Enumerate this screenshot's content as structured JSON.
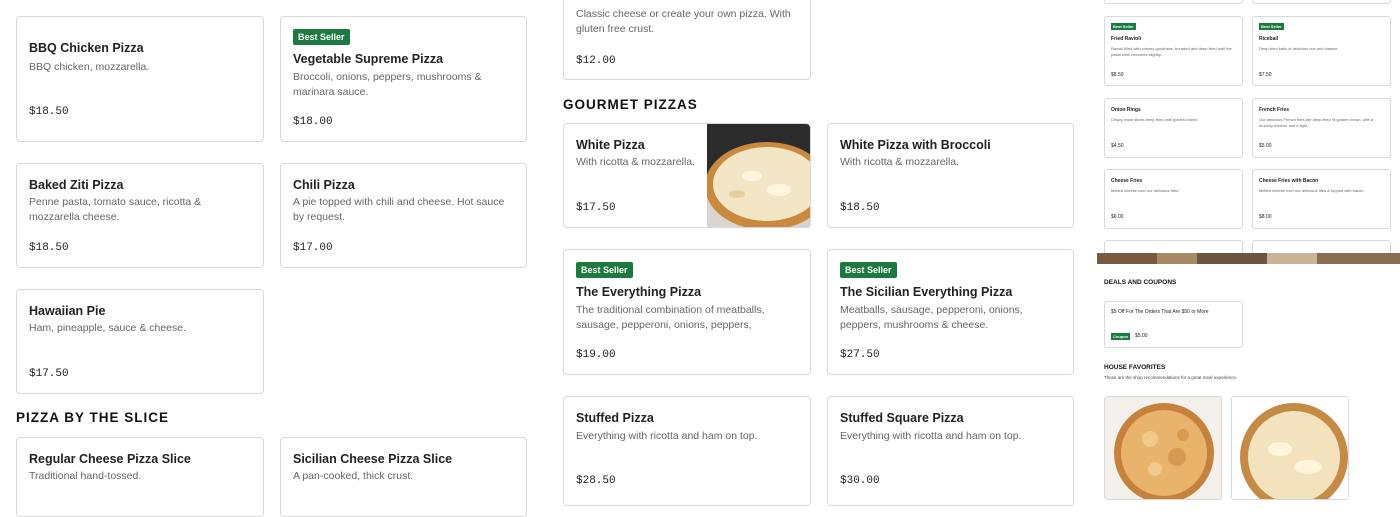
{
  "left_col": {
    "bbq": {
      "name": "BBQ Chicken Pizza",
      "desc": "BBQ chicken, mozzarella.",
      "price": "$18.50"
    },
    "veg": {
      "badge": "Best Seller",
      "name": "Vegetable Supreme Pizza",
      "desc": "Broccoli, onions, peppers, mushrooms & marinara sauce.",
      "price": "$18.00"
    },
    "ziti": {
      "name": "Baked Ziti Pizza",
      "desc": "Penne pasta, tomato sauce, ricotta & mozzarella cheese.",
      "price": "$18.50"
    },
    "chili": {
      "name": "Chili Pizza",
      "desc": "A pie topped with chili and cheese. Hot sauce by request.",
      "price": "$17.00"
    },
    "hawaiian": {
      "name": "Hawaiian Pie",
      "desc": "Ham, pineapple, sauce & cheese.",
      "price": "$17.50"
    }
  },
  "slice_section": {
    "title": "PIZZA BY THE SLICE",
    "regular": {
      "name": "Regular Cheese Pizza Slice",
      "desc": "Traditional hand-tossed."
    },
    "sicilian": {
      "name": "Sicilian Cheese Pizza Slice",
      "desc": "A pan-cooked, thick crust."
    }
  },
  "middle_col": {
    "top_card": {
      "desc": "Classic cheese or create your own pizza. With gluten free crust.",
      "price": "$12.00"
    },
    "gourmet_title": "GOURMET PIZZAS",
    "white": {
      "name": "White Pizza",
      "desc": "With ricotta & mozzarella.",
      "price": "$17.50"
    },
    "white_broccoli": {
      "name": "White Pizza with Broccoli",
      "desc": "With ricotta & mozzarella.",
      "price": "$18.50"
    },
    "everything": {
      "badge": "Best Seller",
      "name": "The Everything Pizza",
      "desc": "The traditional combination of meatballs, sausage, pepperoni, onions, peppers, mushroom...",
      "price": "$19.00"
    },
    "sicilian_everything": {
      "badge": "Best Seller",
      "name": "The Sicilian Everything Pizza",
      "desc": "Meatballs, sausage, pepperoni, onions, peppers, mushrooms & cheese.",
      "price": "$27.50"
    },
    "stuffed": {
      "name": "Stuffed Pizza",
      "desc": "Everything with ricotta and ham on top.",
      "price": "$28.50"
    },
    "stuffed_square": {
      "name": "Stuffed Square Pizza",
      "desc": "Everything with ricotta and ham on top.",
      "price": "$30.00"
    }
  },
  "right_panel": {
    "fried_ravioli": {
      "badge": "Best Seller",
      "name": "Fried Ravioli",
      "desc": "Ravioli filled with cheesy goodness, breaded and deep-fried until the pasta shell becomes slightly...",
      "price": "$8.50"
    },
    "riceball": {
      "badge": "Best Seller",
      "name": "Riceball",
      "desc": "Deep-fried balls of delicious rice and cheese",
      "price": "$7.50"
    },
    "onion_rings": {
      "name": "Onion Rings",
      "desc": "Crispy onion slices deep-fried until golden-brown.",
      "price": "$4.50"
    },
    "french_fries": {
      "name": "French Fries",
      "desc": "Our delicious French fries are deep-fried 'til golden brown, with a crunchy exterior and a light...",
      "price": "$5.00"
    },
    "cheese_fries": {
      "name": "Cheese Fries",
      "desc": "Melted cheese over our delicious fries.",
      "price": "$6.00"
    },
    "cheese_fries_bacon": {
      "name": "Cheese Fries with Bacon",
      "desc": "Melted cheese over our delicious fries & topped with bacon.",
      "price": "$8.00"
    },
    "deals_title": "DEALS AND COUPONS",
    "deal": {
      "name": "$5 Off For The Orders That Are $50 or More",
      "badge": "Coupon",
      "price": "$5.00"
    },
    "favorites_title": "HOUSE FAVORITES",
    "favorites_sub": "These are the shop recommendations for a great meal experience."
  },
  "colors": {
    "badge": "#1a7a3f",
    "border": "#d9d9d9"
  }
}
